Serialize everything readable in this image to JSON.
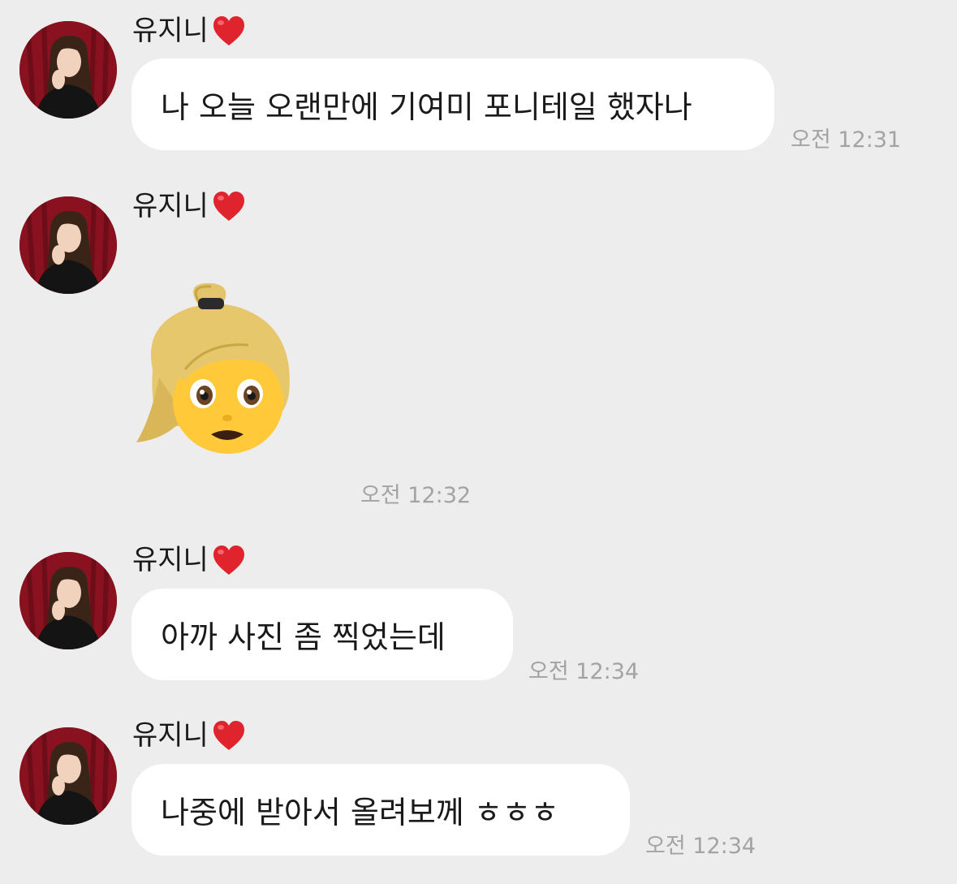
{
  "sender_name": "유지니",
  "messages": [
    {
      "type": "text",
      "text": "나 오늘 오랜만에 기여미 포니테일 했자나",
      "time": "오전 12:31"
    },
    {
      "type": "emoji",
      "emoji_name": "woman-blond-ponytail-emoji",
      "time": "오전 12:32"
    },
    {
      "type": "text",
      "text": "아까 사진 좀 찍었는데",
      "time": "오전 12:34"
    },
    {
      "type": "text",
      "text": "나중에 받아서 올려보께 ㅎㅎㅎ",
      "time": "오전 12:34"
    }
  ],
  "colors": {
    "background": "#ededed",
    "bubble": "#ffffff",
    "timestamp": "#a3a3a3",
    "heart": "#e0242e",
    "avatar_bg": "#8a1220"
  }
}
